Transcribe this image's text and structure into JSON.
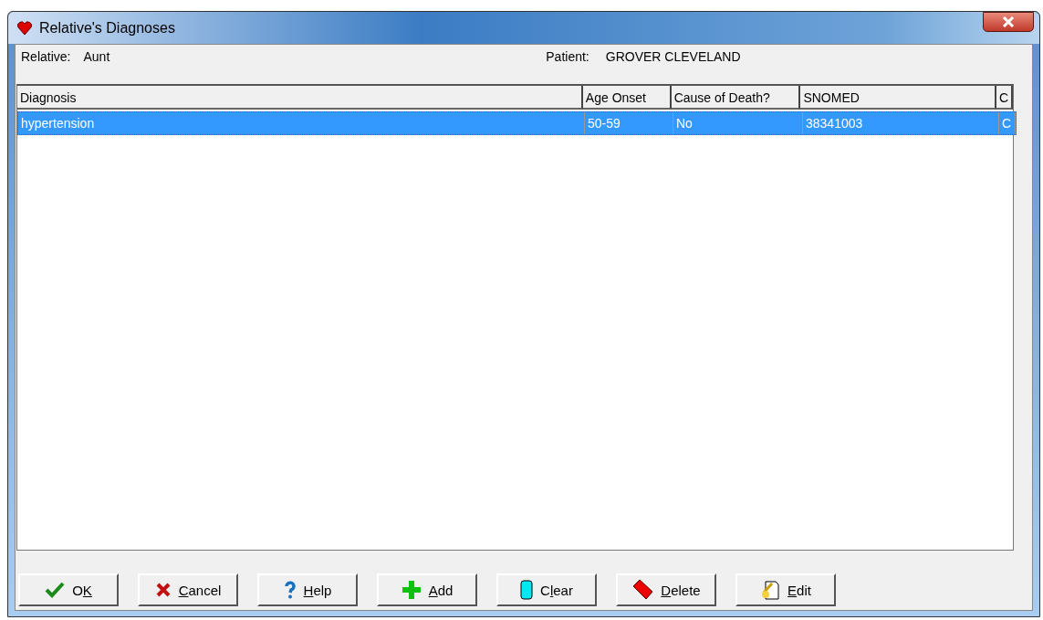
{
  "window": {
    "title": "Relative's Diagnoses"
  },
  "header": {
    "relative_label": "Relative:",
    "relative": "Aunt",
    "patient_label": "Patient:",
    "patient": "GROVER CLEVELAND"
  },
  "table": {
    "columns": [
      "Diagnosis",
      "Age Onset",
      "Cause of Death?",
      "SNOMED",
      "C"
    ],
    "rows": [
      {
        "cells": [
          "hypertension",
          "50-59",
          "No",
          "38341003",
          "C"
        ],
        "selected": true
      }
    ]
  },
  "buttons": [
    {
      "kind": "ok",
      "label": [
        {
          "text": "O",
          "underlined": false
        },
        {
          "text": "K",
          "underlined": true
        }
      ]
    },
    {
      "kind": "cancel",
      "label": [
        {
          "text": "C",
          "underlined": true
        },
        {
          "text": "ancel",
          "underlined": false
        }
      ]
    },
    {
      "kind": "help",
      "label": [
        {
          "text": "H",
          "underlined": true
        },
        {
          "text": "elp",
          "underlined": false
        }
      ]
    },
    {
      "kind": "add",
      "label": [
        {
          "text": "A",
          "underlined": true
        },
        {
          "text": "dd",
          "underlined": false
        }
      ]
    },
    {
      "kind": "clear",
      "label": [
        {
          "text": "C",
          "underlined": false
        },
        {
          "text": "l",
          "underlined": true
        },
        {
          "text": "ear",
          "underlined": false
        }
      ]
    },
    {
      "kind": "delete",
      "label": [
        {
          "text": "D",
          "underlined": true
        },
        {
          "text": "elete",
          "underlined": false
        }
      ]
    },
    {
      "kind": "edit",
      "label": [
        {
          "text": "E",
          "underlined": true
        },
        {
          "text": "dit",
          "underlined": false
        }
      ]
    }
  ]
}
